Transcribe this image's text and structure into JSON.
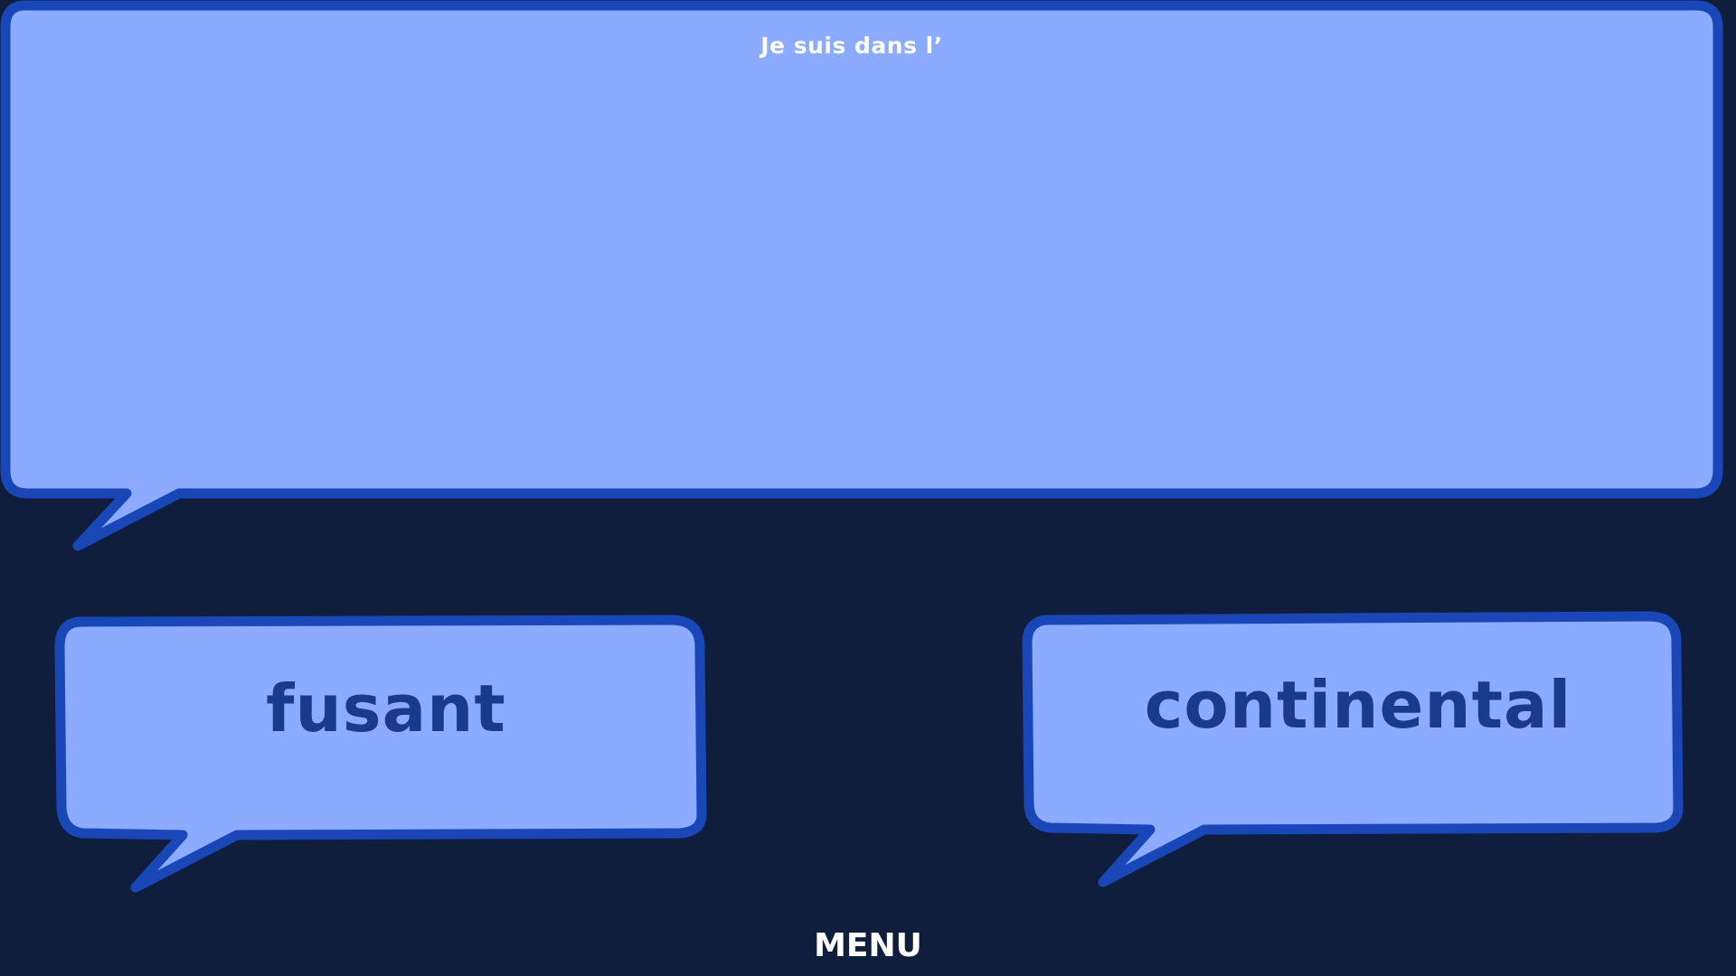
{
  "question": {
    "text": "Je suis dans l’"
  },
  "answers": [
    {
      "label": "fusant"
    },
    {
      "label": "continental"
    }
  ],
  "menu": {
    "label": "MENU"
  },
  "colors": {
    "background": "#101e3d",
    "bubble_fill": "#8aabff",
    "bubble_border": "#1a47b8",
    "answer_text": "#1c3a8c",
    "question_text": "#ffffff",
    "menu_text": "#ffffff"
  }
}
